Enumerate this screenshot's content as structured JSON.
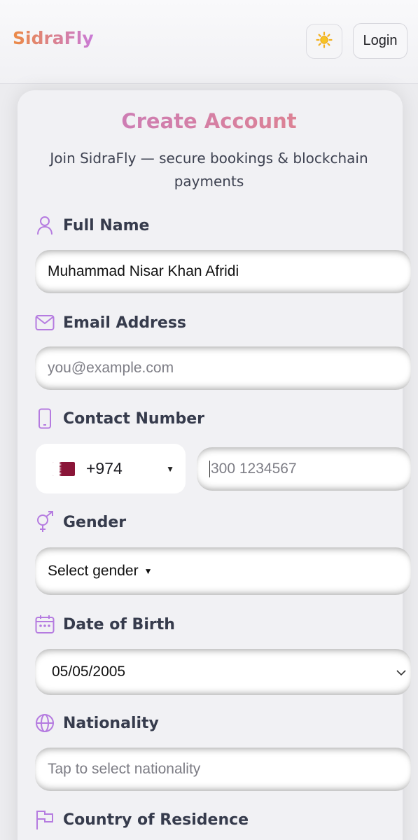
{
  "header": {
    "brand": "SidraFly",
    "theme_icon": "sun-icon",
    "login_label": "Login"
  },
  "form": {
    "title": "Create Account",
    "subtitle": "Join SidraFly — secure bookings & blockchain payments",
    "full_name": {
      "label": "Full Name",
      "icon": "user-icon",
      "value": "Muhammad Nisar Khan Afridi"
    },
    "email": {
      "label": "Email Address",
      "icon": "mail-icon",
      "placeholder": "you@example.com"
    },
    "contact": {
      "label": "Contact Number",
      "icon": "phone-icon",
      "country_code": "+974",
      "country_flag": "qatar-flag",
      "placeholder": "300 1234567"
    },
    "gender": {
      "label": "Gender",
      "icon": "gender-icon",
      "value": "Select gender"
    },
    "dob": {
      "label": "Date of Birth",
      "icon": "calendar-icon",
      "value": "05/05/2005"
    },
    "nationality": {
      "label": "Nationality",
      "icon": "globe-icon",
      "placeholder": "Tap to select nationality"
    },
    "residence": {
      "label": "Country of Residence",
      "icon": "flag-icon"
    }
  },
  "colors": {
    "accent_purple": "#b57be0",
    "brand_orange": "#ec8a45",
    "label_text": "#363b4c"
  }
}
